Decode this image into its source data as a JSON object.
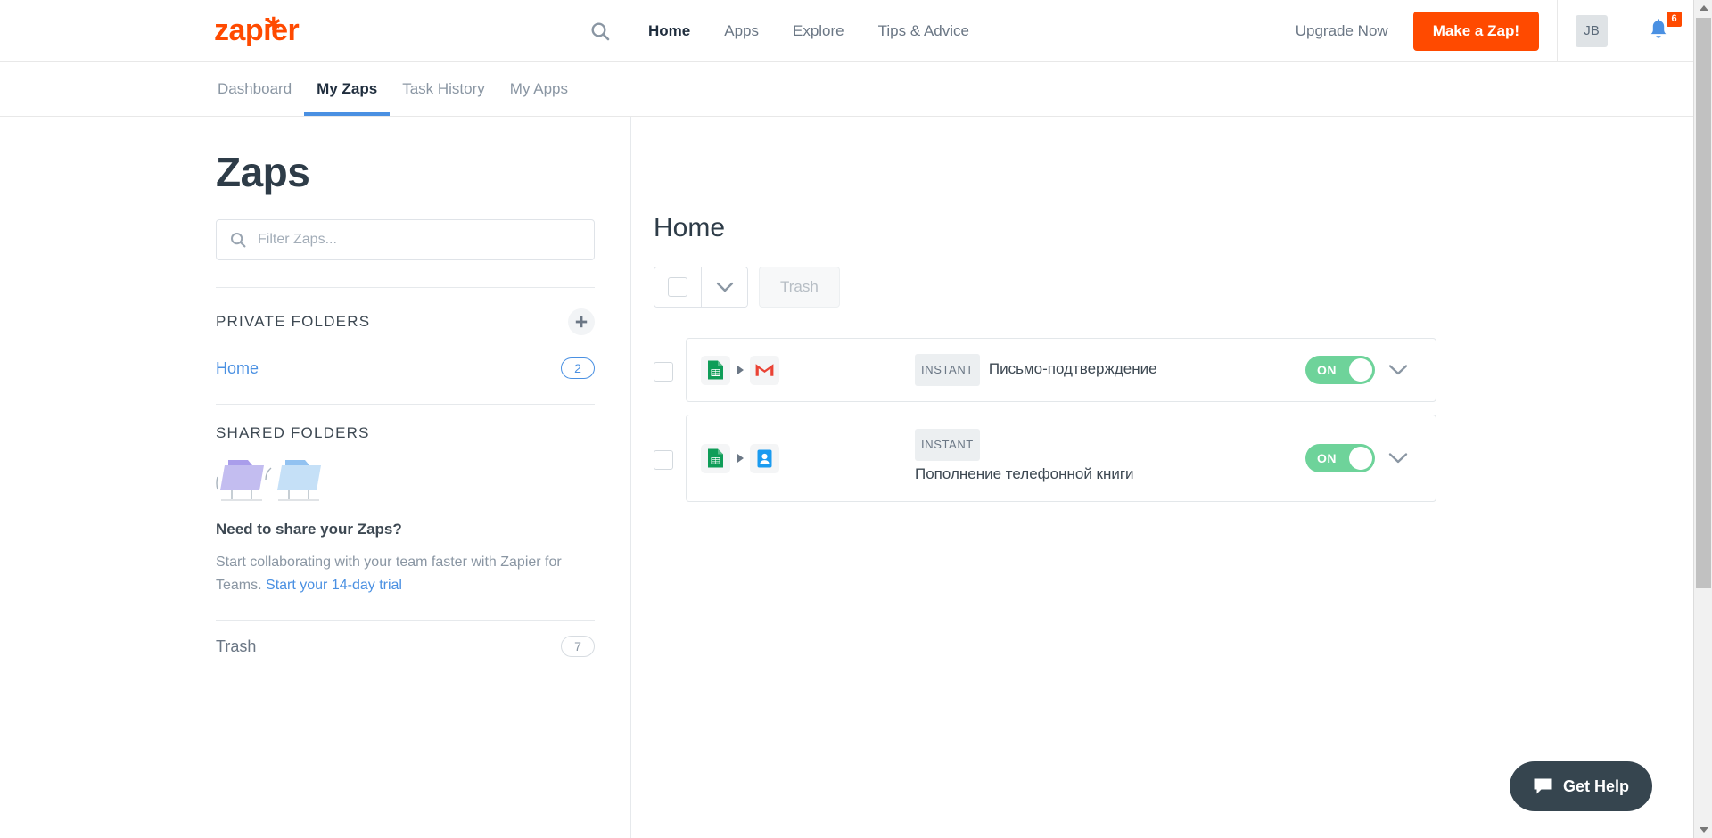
{
  "brand": {
    "logo_text": "zapier",
    "logo_color": "#ff4a00",
    "accent_color": "#4a90e2",
    "toggle_on_color": "#6ed39a"
  },
  "header": {
    "search_icon": "search-icon",
    "nav": [
      {
        "label": "Home",
        "active": true
      },
      {
        "label": "Apps",
        "active": false
      },
      {
        "label": "Explore",
        "active": false
      },
      {
        "label": "Tips & Advice",
        "active": false
      }
    ],
    "upgrade_label": "Upgrade Now",
    "make_zap_label": "Make a Zap!",
    "avatar_initials": "JB",
    "notifications_icon": "bell-icon",
    "notifications_count": "6"
  },
  "subnav": {
    "items": [
      {
        "label": "Dashboard",
        "active": false
      },
      {
        "label": "My Zaps",
        "active": true
      },
      {
        "label": "Task History",
        "active": false
      },
      {
        "label": "My Apps",
        "active": false
      }
    ]
  },
  "page": {
    "title": "Zaps"
  },
  "sidebar": {
    "filter_placeholder": "Filter Zaps...",
    "filter_value": "",
    "private_folders_heading": "PRIVATE FOLDERS",
    "add_folder_icon": "plus-icon",
    "folders": [
      {
        "name": "Home",
        "count": "2",
        "active": true
      }
    ],
    "shared_folders_heading": "SHARED FOLDERS",
    "share_illustration": "two-folders-illustration",
    "share_title": "Need to share your Zaps?",
    "share_desc_part1": "Start collaborating with your team faster with Zapier for Teams. ",
    "share_link": "Start your 14-day trial",
    "trash": {
      "name": "Trash",
      "count": "7"
    }
  },
  "main": {
    "folder_title": "Home",
    "toolbar": {
      "select_all_checkbox": "",
      "dropdown_icon": "chevron-down-icon",
      "trash_label": "Trash",
      "trash_disabled": true
    },
    "zaps": [
      {
        "checkbox": "",
        "trigger_app": "google-sheets",
        "action_app": "gmail",
        "badge": "INSTANT",
        "name": "Письмо-подтверждение",
        "toggle_label": "ON",
        "toggle_state": "on",
        "expand_icon": "chevron-down-icon"
      },
      {
        "checkbox": "",
        "trigger_app": "google-sheets",
        "action_app": "google-contacts",
        "badge": "INSTANT",
        "name": "Пополнение телефонной книги",
        "toggle_label": "ON",
        "toggle_state": "on",
        "expand_icon": "chevron-down-icon"
      }
    ]
  },
  "help": {
    "label": "Get Help",
    "icon": "chat-bubble-icon"
  }
}
